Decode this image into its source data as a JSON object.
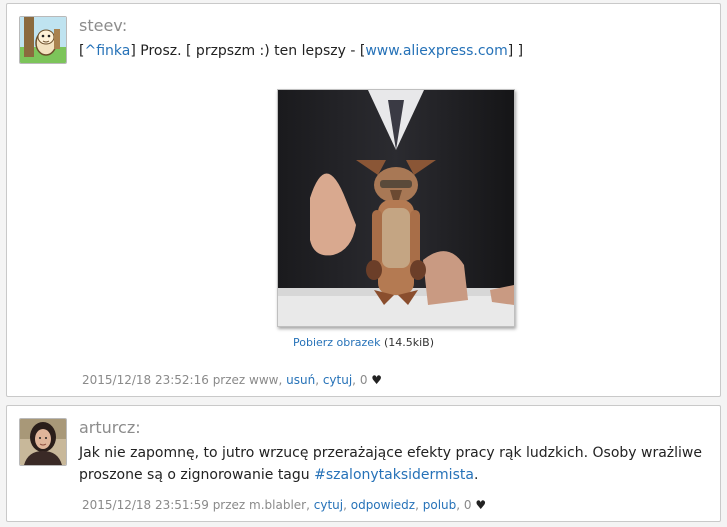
{
  "entries": [
    {
      "author": "steev",
      "colon": ":",
      "avatar": "avatar-cartoon-character",
      "body": {
        "open_bracket": "[",
        "mention": "^finka",
        "close_bracket": "]",
        "text1": " Prosz. [ przpszm :) ten lepszy - [",
        "link": "www.aliexpress.com",
        "text2": "] ]"
      },
      "image": {
        "download_label": "Pobierz obrazek",
        "size": " (14.5kiB)"
      },
      "meta": {
        "timestamp": "2015/12/18 23:52:16",
        "by": " przez www, ",
        "actions": [
          "usuń",
          "cytuj"
        ],
        "votes": "0",
        "heart": "♥"
      }
    },
    {
      "author": "arturcz",
      "colon": ":",
      "avatar": "avatar-woman-photo",
      "body": {
        "text1": "Jak nie zapomnę, to jutro wrzucę przerażające efekty pracy rąk ludzkich. Osoby wrażliwe proszone są o zignorowanie tagu ",
        "tag": "#szalonytaksidermista",
        "text2": "."
      },
      "meta": {
        "timestamp": "2015/12/18 23:51:59",
        "by": " przez m.blabler, ",
        "actions": [
          "cytuj",
          "odpowiedz",
          "polub"
        ],
        "votes": "0",
        "heart": "♥"
      }
    }
  ],
  "colors": {
    "link": "#2672b8",
    "meta": "#8a8a8a",
    "author": "#8c8c8c"
  }
}
